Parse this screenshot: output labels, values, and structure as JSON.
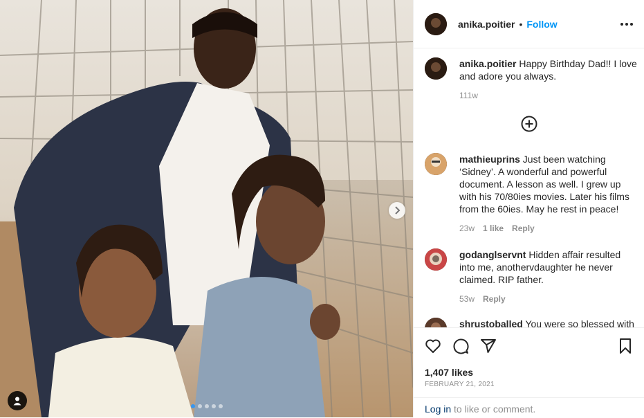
{
  "post": {
    "username": "anika.poitier",
    "follow_label": "Follow",
    "separator": "•",
    "caption": "Happy Birthday Dad!! I love and adore you always.",
    "caption_age": "111w",
    "likes": "1,407 likes",
    "date": "FEBRUARY 21, 2021",
    "carousel": {
      "count": 5,
      "active_index": 0
    }
  },
  "comments": [
    {
      "username": "mathieuprins",
      "text": "Just been watching ‘Sidney’. A wonderful and powerful document. A lesson as well. I grew up with his 70/80ies movies. Later his films from the 60ies. May he rest in peace!",
      "age": "23w",
      "likes": "1 like",
      "reply": "Reply"
    },
    {
      "username": "godanglservnt",
      "text": "Hidden affair resulted into me, anothervdaughter he never claimed. RIP father.",
      "age": "53w",
      "reply": "Reply"
    },
    {
      "username": "shrustoballed",
      "text": "You were so blessed with"
    }
  ],
  "footer": {
    "login_link": "Log in",
    "login_rest": " to like or comment."
  },
  "icons": {
    "like": "heart-icon",
    "comment": "comment-icon",
    "share": "paper-plane-icon",
    "save": "bookmark-icon",
    "more": "more-options-icon",
    "load_more": "plus-circle-icon",
    "next": "chevron-right-icon",
    "tags": "user-tag-icon"
  },
  "colors": {
    "accent": "#0095f6",
    "text": "#262626",
    "muted": "#8e8e8e",
    "link": "#00376b"
  }
}
